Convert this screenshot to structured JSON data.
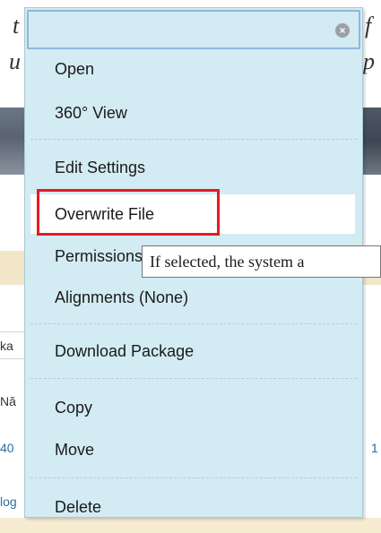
{
  "background": {
    "frag_top_left": "t",
    "frag_top_left_2": "u",
    "frag_top_right": "f",
    "frag_top_right_2": "p",
    "frag_ka": "ka",
    "frag_na": "Nă",
    "frag_40": "40",
    "frag_1": "1",
    "frag_lo": "log"
  },
  "menu": {
    "search": {
      "value": "",
      "placeholder": ""
    },
    "clear_icon": "×",
    "items": {
      "open": "Open",
      "view360": "360° View",
      "edit_settings": "Edit Settings",
      "overwrite_file": "Overwrite File",
      "permissions": "Permissions",
      "alignments": "Alignments (None)",
      "download_package": "Download Package",
      "copy": "Copy",
      "move": "Move",
      "delete": "Delete"
    }
  },
  "tooltip": {
    "text": "If selected, the system a"
  },
  "colors": {
    "menu_background": "#d3ebf3",
    "highlight_border": "#e31b23",
    "search_border": "#8fb7d8"
  }
}
